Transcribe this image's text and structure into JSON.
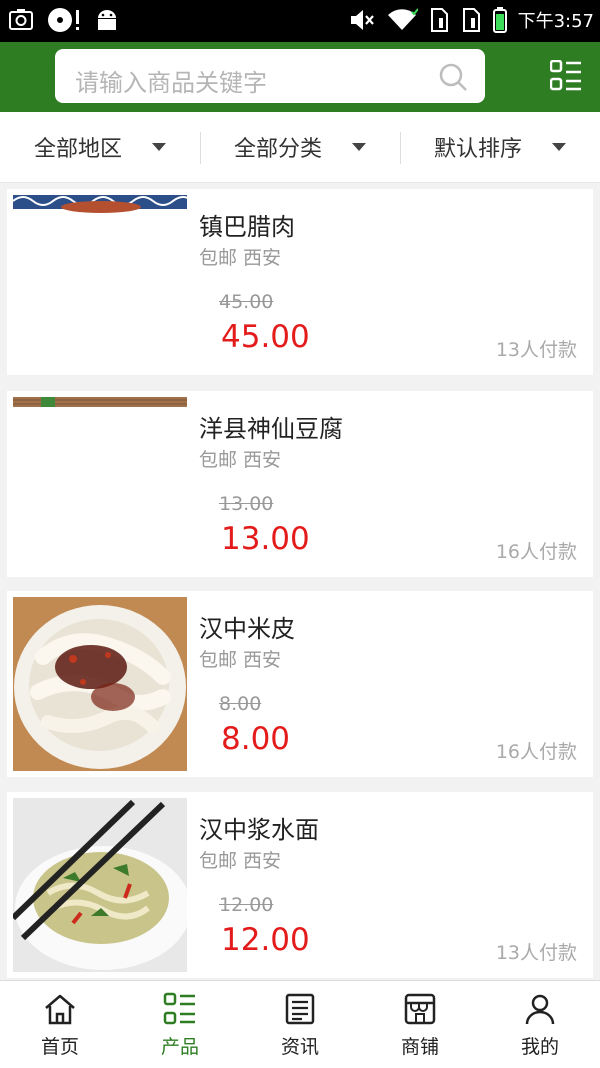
{
  "status_bar": {
    "time": "下午3:57"
  },
  "search": {
    "placeholder": "请输入商品关键字"
  },
  "filters": [
    {
      "label": "全部地区"
    },
    {
      "label": "全部分类"
    },
    {
      "label": "默认排序"
    }
  ],
  "products": [
    {
      "title": "镇巴腊肉",
      "meta": "包邮 西安",
      "old_price": "45.00",
      "price": "45.00",
      "paid": "13人付款"
    },
    {
      "title": "洋县神仙豆腐",
      "meta": "包邮 西安",
      "old_price": "13.00",
      "price": "13.00",
      "paid": "16人付款"
    },
    {
      "title": "汉中米皮",
      "meta": "包邮 西安",
      "old_price": "8.00",
      "price": "8.00",
      "paid": "16人付款"
    },
    {
      "title": "汉中浆水面",
      "meta": "包邮 西安",
      "old_price": "12.00",
      "price": "12.00",
      "paid": "13人付款"
    }
  ],
  "bottom_nav": [
    {
      "label": "首页",
      "icon": "home-icon"
    },
    {
      "label": "产品",
      "icon": "product-list-icon",
      "active": true
    },
    {
      "label": "资讯",
      "icon": "news-icon"
    },
    {
      "label": "商铺",
      "icon": "shop-icon"
    },
    {
      "label": "我的",
      "icon": "user-icon"
    }
  ],
  "colors": {
    "brand": "#2e7d23",
    "price": "#e31b1b"
  }
}
